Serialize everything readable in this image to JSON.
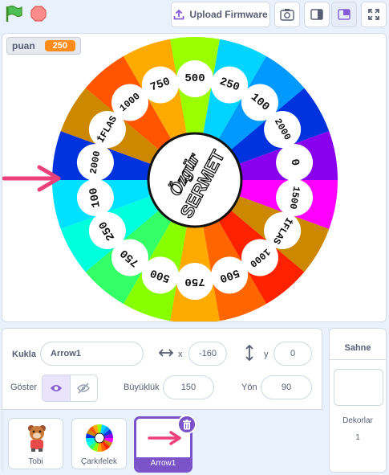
{
  "toolbar": {
    "green_flag": "green-flag-icon",
    "stop": "stop-icon",
    "upload_label": "Upload Firmware",
    "camera": "camera-icon",
    "small_stage": "small-stage-icon",
    "large_stage": "large-stage-icon",
    "fullscreen": "fullscreen-icon"
  },
  "stage": {
    "monitor": {
      "label": "puan",
      "value": "250"
    },
    "wheel": {
      "segments": [
        {
          "label": "250",
          "color": "#00d4ff"
        },
        {
          "label": "100",
          "color": "#0099ff"
        },
        {
          "label": "2000",
          "color": "#0033dd"
        },
        {
          "label": "0",
          "color": "#8800ee"
        },
        {
          "label": "1500",
          "color": "#ff00ff"
        },
        {
          "label": "İFLAS",
          "color": "#cc8800"
        },
        {
          "label": "1000",
          "color": "#ff2200"
        },
        {
          "label": "500",
          "color": "#ff6600"
        },
        {
          "label": "750",
          "color": "#ffaa00"
        },
        {
          "label": "500",
          "color": "#88ff00"
        },
        {
          "label": "750",
          "color": "#33ff66"
        },
        {
          "label": "250",
          "color": "#00ffdd"
        },
        {
          "label": "100",
          "color": "#00e0ff"
        },
        {
          "label": "2000",
          "color": "#0033dd"
        },
        {
          "label": "İFLAS",
          "color": "#cc8800"
        },
        {
          "label": "1000",
          "color": "#ff5500"
        },
        {
          "label": "750",
          "color": "#ffaa00"
        },
        {
          "label": "500",
          "color": "#99ff00"
        }
      ],
      "center_line1": "Özgür",
      "center_line2": "SERMET"
    }
  },
  "sprite_info": {
    "sprite_label": "Kukla",
    "sprite_name": "Arrow1",
    "x_label": "x",
    "x_value": "-160",
    "y_label": "y",
    "y_value": "0",
    "show_label": "Göster",
    "size_label": "Büyüklük",
    "size_value": "150",
    "direction_label": "Yön",
    "direction_value": "90"
  },
  "sprites": [
    {
      "name": "Tobi"
    },
    {
      "name": "Çarkıfelek"
    },
    {
      "name": "Arrow1"
    }
  ],
  "stage_panel": {
    "title": "Sahne",
    "backdrops_label": "Dekorlar",
    "backdrops_count": "1"
  }
}
